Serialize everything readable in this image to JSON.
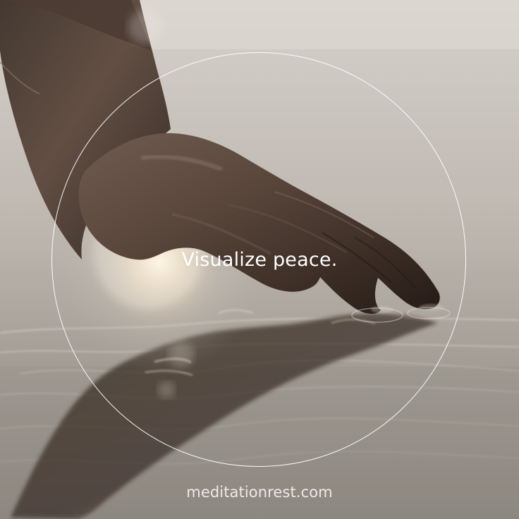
{
  "photo": {
    "subject": "hand-touching-water",
    "palette": {
      "sky": "#d9d4ce",
      "water": "#aaa49d",
      "shadow": "#2e261f",
      "skin": "#6a5549",
      "glow": "#fff1d6"
    }
  },
  "overlay": {
    "headline": "Visualize peace.",
    "website": "meditationrest.com",
    "circle_color": "#ffffff"
  }
}
